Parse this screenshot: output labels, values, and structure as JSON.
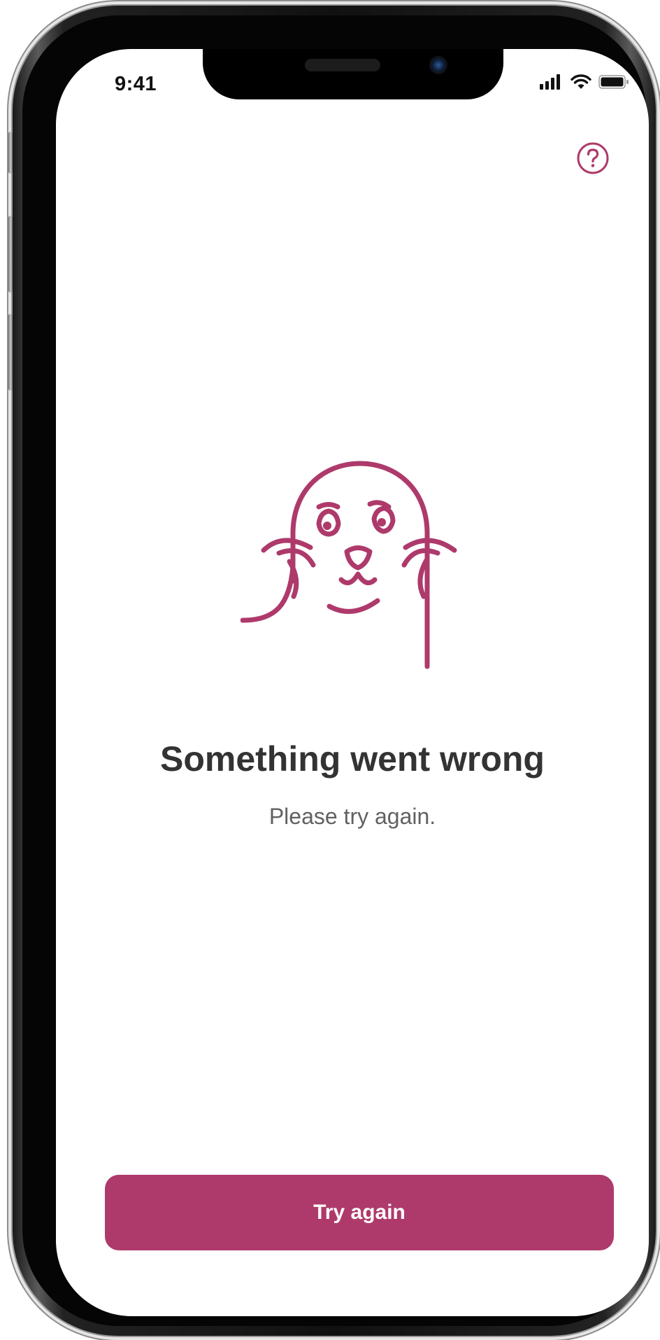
{
  "status_bar": {
    "time": "9:41",
    "icons": [
      "cellular-signal-icon",
      "wifi-icon",
      "battery-icon"
    ]
  },
  "header": {
    "help_icon": "question-circle-icon"
  },
  "illustration": {
    "icon": "sad-seal-illustration"
  },
  "error": {
    "title": "Something went wrong",
    "message": "Please try again."
  },
  "actions": {
    "primary_label": "Try again"
  },
  "colors": {
    "accent": "#ae3a6b",
    "title_text": "#333333",
    "body_text": "#616161",
    "background": "#ffffff"
  }
}
